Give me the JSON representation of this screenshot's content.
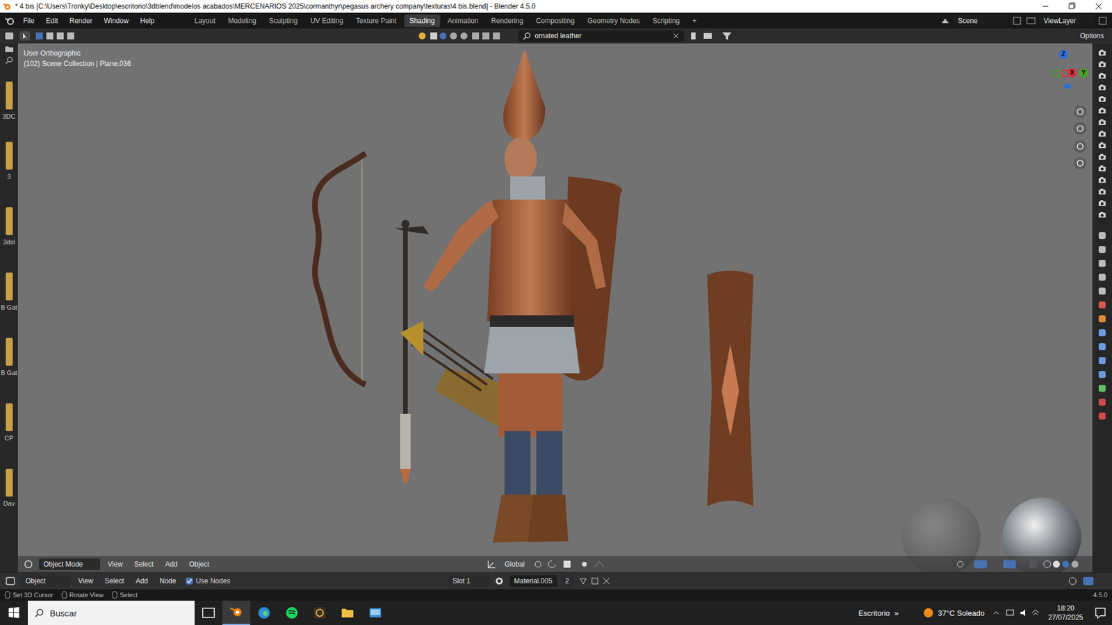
{
  "window": {
    "title": "* 4 bis [C:\\Users\\Tronky\\Desktop\\escritorio\\3dblend\\modelos acabados\\MERCENARIOS 2025\\cormanthyr\\pegasus archery company\\texturas\\4 bis.blend] - Blender 4.5.0"
  },
  "menu": [
    "File",
    "Edit",
    "Render",
    "Window",
    "Help"
  ],
  "workspaces": [
    {
      "label": "Layout",
      "selected": false
    },
    {
      "label": "Modeling",
      "selected": false
    },
    {
      "label": "Sculpting",
      "selected": false
    },
    {
      "label": "UV Editing",
      "selected": false
    },
    {
      "label": "Texture Paint",
      "selected": false
    },
    {
      "label": "Shading",
      "selected": true
    },
    {
      "label": "Animation",
      "selected": false
    },
    {
      "label": "Rendering",
      "selected": false
    },
    {
      "label": "Compositing",
      "selected": false
    },
    {
      "label": "Geometry Nodes",
      "selected": false
    },
    {
      "label": "Scripting",
      "selected": false
    }
  ],
  "add_workspace": "+",
  "scene": "Scene",
  "view_layer": "ViewLayer",
  "viewport": {
    "search": "ornated leather",
    "options": "Options",
    "view_name": "User Orthographic",
    "collection": "(102) Scene Collection | Plane.036",
    "axes": [
      "Z",
      "X",
      "Y"
    ]
  },
  "asset_strip": [
    "3DC",
    "3",
    "3dsl",
    "B Gat",
    "B Gat",
    "CP",
    "Dav"
  ],
  "viewport_header": {
    "mode": "Object Mode",
    "menus": [
      "View",
      "Select",
      "Add",
      "Object"
    ],
    "orientation": "Global"
  },
  "node_header": {
    "editor": "Object",
    "menus": [
      "View",
      "Select",
      "Add",
      "Node"
    ],
    "use_nodes": {
      "label": "Use Nodes",
      "checked": true
    },
    "slot": "Slot 1",
    "material": "Material.005",
    "users": "2"
  },
  "status_bar": {
    "hints": [
      "Set 3D Cursor",
      "Rotate View",
      "Select"
    ],
    "version": "4.5.0"
  },
  "taskbar": {
    "search_placeholder": "Buscar",
    "desktop": "Escritorio",
    "chevron": "»",
    "weather": "37°C Soleado",
    "time": "18:20",
    "date": "27/07/2025"
  }
}
